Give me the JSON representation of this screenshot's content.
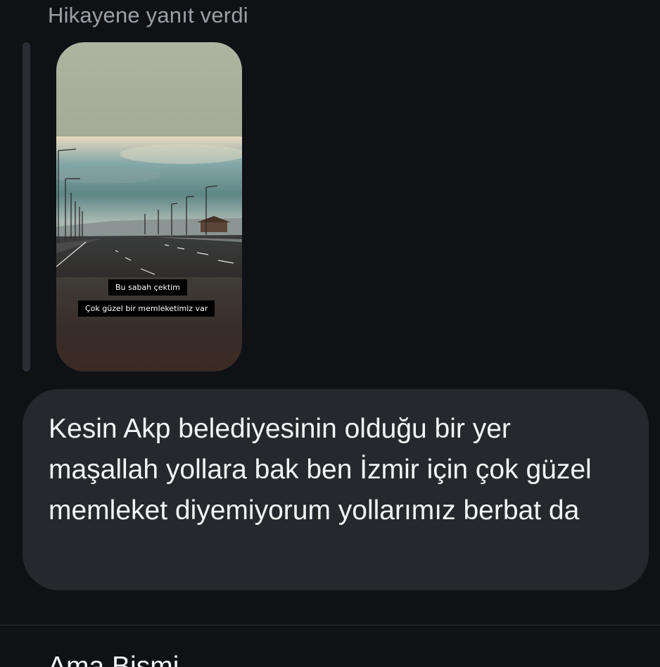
{
  "reply": {
    "header": "Hikayene yanıt verdi"
  },
  "story": {
    "captions": [
      "Bu sabah çektim",
      "Çok güzel bir memleketimiz var"
    ]
  },
  "message": {
    "text": "Kesin Akp belediyesinin olduğu bir yer maşallah yollara bak ben İzmir için çok güzel memleket diyemiyorum yollarımız berbat da"
  },
  "next_message": {
    "text": "Ama Bismi..."
  }
}
